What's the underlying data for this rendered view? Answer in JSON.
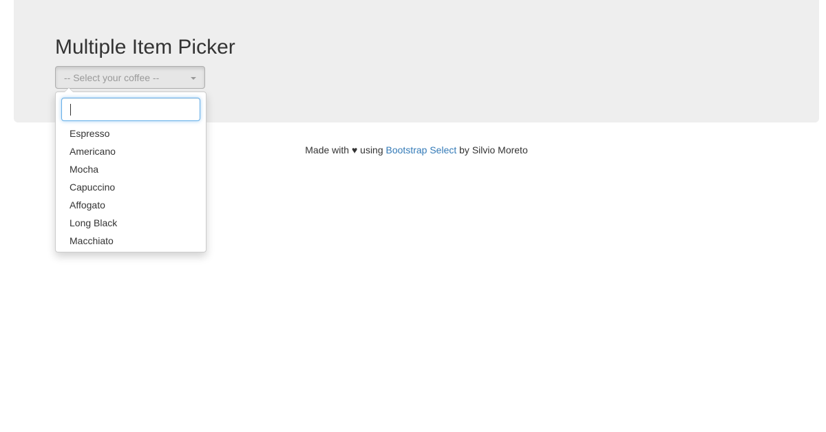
{
  "page": {
    "title": "Multiple Item Picker"
  },
  "picker": {
    "placeholder": "-- Select your coffee --",
    "search_value": "",
    "options": [
      {
        "label": "Espresso"
      },
      {
        "label": "Americano"
      },
      {
        "label": "Mocha"
      },
      {
        "label": "Capuccino"
      },
      {
        "label": "Affogato"
      },
      {
        "label": "Long Black"
      },
      {
        "label": "Macchiato"
      }
    ]
  },
  "footer": {
    "made_with": "Made with",
    "heart": "♥",
    "using": "using",
    "link_text": "Bootstrap Select",
    "by": "by Silvio Moreto"
  },
  "colors": {
    "jumbotron_bg": "#eeeeee",
    "link": "#337ab7",
    "focus_border": "#66afe9",
    "placeholder_text": "#999999"
  },
  "icons": {
    "dropdown_caret": "caret-down-icon",
    "footer_heart": "heart-icon"
  }
}
